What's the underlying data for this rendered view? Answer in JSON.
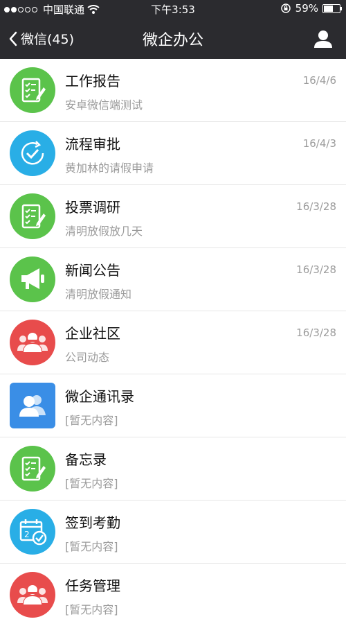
{
  "status_bar": {
    "carrier": "中国联通",
    "time": "下午3:53",
    "battery_percent": "59%",
    "battery_level": 0.59,
    "signal_filled": 2,
    "signal_total": 5
  },
  "nav": {
    "back_label": "微信(45)",
    "title": "微企办公"
  },
  "items": [
    {
      "name": "工作报告",
      "sub": "安卓微信端测试",
      "date": "16/4/6",
      "icon": "report-icon",
      "color": "#5bc34b",
      "shape": "round"
    },
    {
      "name": "流程审批",
      "sub": "黄加林的请假申请",
      "date": "16/4/3",
      "icon": "approval-icon",
      "color": "#29aee6",
      "shape": "round"
    },
    {
      "name": "投票调研",
      "sub": "清明放假放几天",
      "date": "16/3/28",
      "icon": "vote-icon",
      "color": "#5bc34b",
      "shape": "round"
    },
    {
      "name": "新闻公告",
      "sub": "清明放假通知",
      "date": "16/3/28",
      "icon": "megaphone-icon",
      "color": "#5bc34b",
      "shape": "round"
    },
    {
      "name": "企业社区",
      "sub": "公司动态",
      "date": "16/3/28",
      "icon": "community-icon",
      "color": "#e84c4c",
      "shape": "round"
    },
    {
      "name": "微企通讯录",
      "sub": "[暂无内容]",
      "date": "",
      "icon": "contacts-icon",
      "color": "#3a8ee6",
      "shape": "square"
    },
    {
      "name": "备忘录",
      "sub": "[暂无内容]",
      "date": "",
      "icon": "memo-icon",
      "color": "#5bc34b",
      "shape": "round"
    },
    {
      "name": "签到考勤",
      "sub": "[暂无内容]",
      "date": "",
      "icon": "calendar-check-icon",
      "color": "#29aee6",
      "shape": "round"
    },
    {
      "name": "任务管理",
      "sub": "[暂无内容]",
      "date": "",
      "icon": "task-icon",
      "color": "#e84c4c",
      "shape": "round"
    }
  ]
}
